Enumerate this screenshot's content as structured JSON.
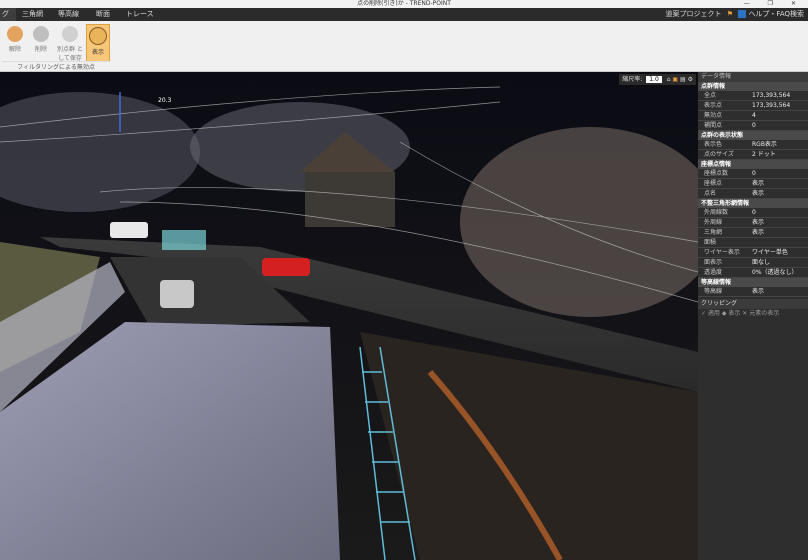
{
  "window": {
    "title": "点の削除(引き)か - TREND-POINT",
    "controls": "—  ❐  ✕"
  },
  "menu": {
    "tabs": [
      "グ",
      "三角網",
      "等高線",
      "断面",
      "トレース"
    ],
    "project": "道案プロジェクト",
    "help": "ヘルプ・FAQ検索"
  },
  "ribbon": {
    "buttons": [
      {
        "label": "解除"
      },
      {
        "label": "削除"
      },
      {
        "label": "別点群 として保存"
      },
      {
        "label": "表示"
      }
    ],
    "group_label": "フィルタリングによる無効点"
  },
  "viewport": {
    "toolbar_label": "縮尺率:",
    "scale": "1.0",
    "measure_label": "20.3"
  },
  "panel": {
    "header": "データ情報",
    "sections": [
      {
        "title": "点群情報",
        "rows": [
          [
            "全点",
            "173,393,564"
          ],
          [
            "表示点",
            "173,393,564"
          ],
          [
            "無効点",
            "4"
          ],
          [
            "補間点",
            "0"
          ]
        ]
      },
      {
        "title": "点群の表示状態",
        "rows": [
          [
            "表示色",
            "RGB表示"
          ],
          [
            "点のサイズ",
            "2 ドット"
          ]
        ]
      },
      {
        "title": "座標点情報",
        "rows": [
          [
            "座標点数",
            "0"
          ],
          [
            "座標点",
            "表示"
          ],
          [
            "点名",
            "表示"
          ]
        ]
      },
      {
        "title": "不整三角形網情報",
        "rows": [
          [
            "外周線数",
            "0"
          ],
          [
            "外周線",
            "表示"
          ],
          [
            "三角網",
            "表示"
          ],
          [
            "面積",
            ""
          ],
          [
            "ワイヤー表示",
            "ワイヤー単色"
          ],
          [
            "面表示",
            "面なし"
          ],
          [
            "透過度",
            "0%（透過なし）"
          ]
        ]
      },
      {
        "title": "等高線情報",
        "rows": [
          [
            "等高線",
            "表示"
          ]
        ]
      }
    ],
    "clipping": {
      "title": "クリッピング",
      "actions": "✓ 適用  ◆ 表示  ✕ 元素の表示"
    }
  },
  "colors": {
    "accent": "#f7c77a",
    "panel": "#2e2e2e"
  }
}
